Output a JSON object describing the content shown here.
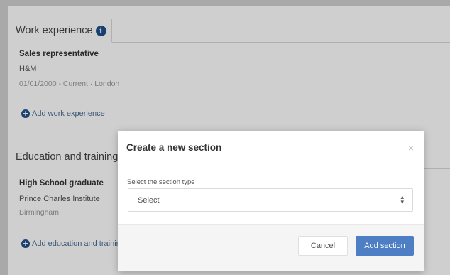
{
  "work_section": {
    "title": "Work experience",
    "entry": {
      "job_title": "Sales representative",
      "employer": "H&M",
      "meta": "01/01/2000 - Current · London"
    },
    "add_link": "Add work experience"
  },
  "education_section": {
    "title": "Education and training",
    "entry": {
      "title": "High School graduate",
      "institution": "Prince Charles Institute",
      "location": "Birmingham"
    },
    "add_link": "Add education and training"
  },
  "modal": {
    "title": "Create a new section",
    "close_glyph": "×",
    "field_label": "Select the section type",
    "select_value": "Select",
    "cancel_label": "Cancel",
    "add_label": "Add section"
  },
  "icons": {
    "info": "info-icon",
    "plus": "plus-icon",
    "close": "close-icon",
    "chevron": "chevron-up-down-icon"
  },
  "colors": {
    "accent": "#4e7fc4",
    "icon_navy": "#1f4f87",
    "link": "#4a6b93"
  }
}
